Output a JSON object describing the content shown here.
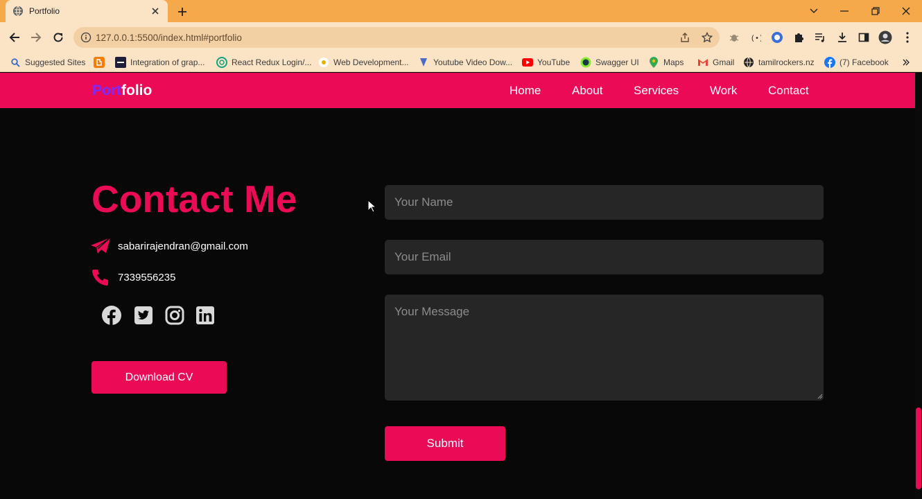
{
  "browser": {
    "tab_title": "Portfolio",
    "url": "127.0.0.1:5500/index.html#portfolio",
    "bookmarks": [
      {
        "label": "Suggested Sites",
        "icon": "search-icon"
      },
      {
        "label": "",
        "icon": "blogger-icon"
      },
      {
        "label": "Integration of grap...",
        "icon": "site-icon"
      },
      {
        "label": "React Redux Login/...",
        "icon": "chatgpt-icon"
      },
      {
        "label": "Web Development...",
        "icon": "site-icon"
      },
      {
        "label": "Youtube Video Dow...",
        "icon": "download-arrow-icon"
      },
      {
        "label": "YouTube",
        "icon": "youtube-icon"
      },
      {
        "label": "Swagger UI",
        "icon": "swagger-icon"
      },
      {
        "label": "Maps",
        "icon": "maps-icon"
      },
      {
        "label": "Gmail",
        "icon": "gmail-icon"
      },
      {
        "label": "tamilrockers.nz",
        "icon": "globe-icon"
      },
      {
        "label": "(7) Facebook",
        "icon": "facebook-icon"
      }
    ]
  },
  "nav": {
    "logo_part1": "Port",
    "logo_part2": "folio",
    "links": [
      "Home",
      "About",
      "Services",
      "Work",
      "Contact"
    ]
  },
  "contact": {
    "title": "Contact Me",
    "email": "sabarirajendran@gmail.com",
    "phone": "7339556235",
    "download_label": "Download CV",
    "social_icons": [
      "facebook-icon",
      "twitter-icon",
      "instagram-icon",
      "linkedin-icon"
    ]
  },
  "form": {
    "name_placeholder": "Your Name",
    "email_placeholder": "Your Email",
    "message_placeholder": "Your Message",
    "submit_label": "Submit"
  },
  "colors": {
    "accent": "#ea0a55",
    "background": "#080808",
    "field_bg": "#262626",
    "browser_frame": "#f6a94a"
  }
}
